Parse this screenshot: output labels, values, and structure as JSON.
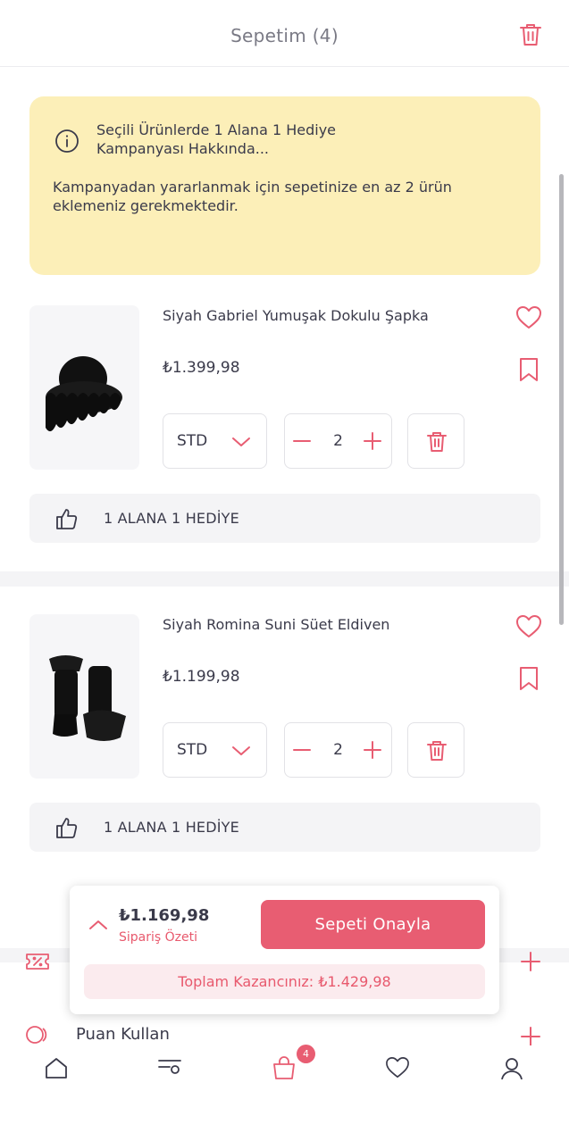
{
  "header": {
    "title": "Sepetim (4)",
    "trash_icon": "trash-icon"
  },
  "info": {
    "icon": "info-icon",
    "title": "Seçili Ürünlerde 1 Alana 1 Hediye Kampanyası Hakkında...",
    "text": "Kampanyadan yararlanmak için sepetinize en az 2 ürün eklemeniz gerekmektedir."
  },
  "items": [
    {
      "name": "Siyah Gabriel Yumuşak Dokulu Şapka",
      "price": "₺1.399,98",
      "size": "STD",
      "qty": "2",
      "promo": "1 ALANA 1 HEDİYE"
    },
    {
      "name": "Siyah Romina Suni Süet Eldiven",
      "price": "₺1.199,98",
      "size": "STD",
      "qty": "2",
      "promo": "1 ALANA 1 HEDİYE"
    }
  ],
  "extras": {
    "points_label": "Puan Kullan"
  },
  "summary": {
    "total": "₺1.169,98",
    "label": "Sipariş Özeti",
    "confirm": "Sepeti Onayla",
    "savings": "Toplam Kazancınız: ₺1.429,98"
  },
  "nav": {
    "cart_badge": "4"
  },
  "colors": {
    "accent": "#e85d72",
    "info_bg": "#fcefb8",
    "text": "#3a3a4a"
  }
}
